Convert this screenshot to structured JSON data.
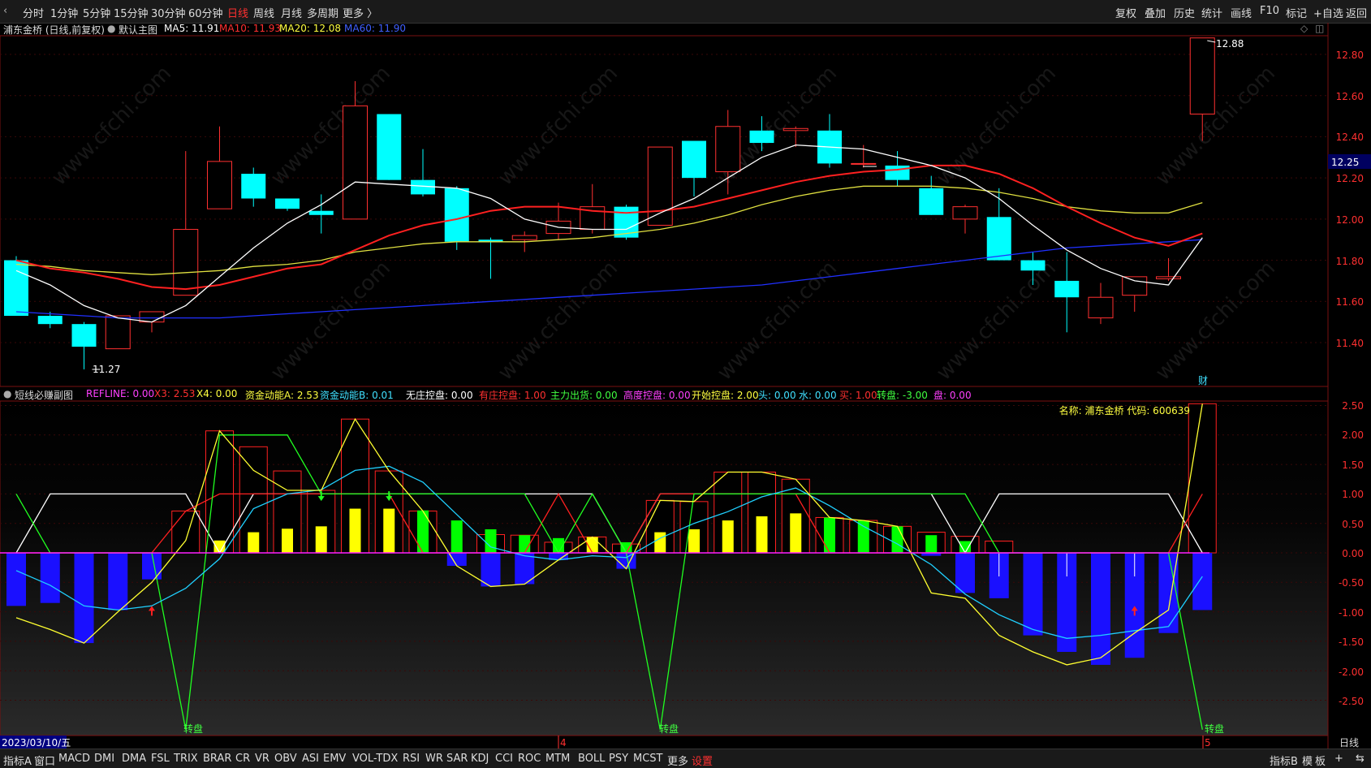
{
  "top_toolbar": {
    "periods": [
      "分时",
      "1分钟",
      "5分钟",
      "15分钟",
      "30分钟",
      "60分钟",
      "日线",
      "周线",
      "月线",
      "多周期",
      "更多 〉"
    ],
    "active": "日线",
    "right_buttons": [
      "复权",
      "叠加",
      "历史",
      "统计",
      "画线",
      "F10",
      "标记",
      "+自选",
      "返回"
    ]
  },
  "main_chart": {
    "title": "浦东金桥 (日线,前复权)",
    "indicator_name": "默认主图",
    "ma5": "MA5: 11.91",
    "ma10": "MA10: 11.93",
    "ma20": "MA20: 12.08",
    "ma60": "MA60: 11.90",
    "y_ticks": [
      "12.80",
      "12.60",
      "12.40",
      "12.20",
      "12.00",
      "11.80",
      "11.60",
      "11.40"
    ],
    "current_price": "12.25",
    "high_label": "12.88",
    "low_label": "11.27",
    "cai_label": "财"
  },
  "sub_chart": {
    "title": "短线必赚副图",
    "refline": "REFLINE: 0.00",
    "x3": "X3: 2.53",
    "x4": "X4: 0.00",
    "zjA": "资金动能A: 2.53",
    "zjB": "资金动能B: 0.01",
    "wzkp": "无庄控盘: 0.00",
    "yzkp": "有庄控盘: 1.00",
    "zlch": "主力出货: 0.00",
    "gdkp": "高度控盘: 0.00",
    "kskp": "开始控盘: 2.00",
    "tou": "头: 0.00",
    "shui": "水: 0.00",
    "mai": "买: 1.00",
    "zhuanpan": "转盘: -3.00",
    "pan": "盘: 0.00",
    "name_code": "名称: 浦东金桥 代码: 600639",
    "y_ticks": [
      "2.50",
      "2.00",
      "1.50",
      "1.00",
      "0.50",
      "0.00",
      "-0.50",
      "-1.00",
      "-1.50",
      "-2.00",
      "-2.50"
    ],
    "zp_labels": [
      "转盘",
      "转盘",
      "转盘"
    ]
  },
  "x_axis": {
    "date": "2023/03/10/五",
    "m4": "4",
    "m5": "5",
    "period": "日线"
  },
  "bottom_tabs": [
    "指标A",
    "窗口",
    "MACD",
    "DMI",
    "DMA",
    "FSL",
    "TRIX",
    "BRAR",
    "CR",
    "VR",
    "OBV",
    "ASI",
    "EMV",
    "VOL-TDX",
    "RSI",
    "WR",
    "SAR",
    "KDJ",
    "CCI",
    "ROC",
    "MTM",
    "BOLL",
    "PSY",
    "MCST",
    "更多",
    "设置"
  ],
  "bottom_right": [
    "指标B",
    "模",
    "板",
    "+",
    "⇆"
  ],
  "watermark": "www.cfchi.com",
  "chart_data": {
    "type": "candlestick",
    "candles": [
      {
        "o": 11.8,
        "h": 11.82,
        "l": 11.53,
        "c": 11.53
      },
      {
        "o": 11.53,
        "h": 11.55,
        "l": 11.47,
        "c": 11.49
      },
      {
        "o": 11.49,
        "h": 11.5,
        "l": 11.27,
        "c": 11.38
      },
      {
        "o": 11.37,
        "h": 11.53,
        "l": 11.37,
        "c": 11.53
      },
      {
        "o": 11.5,
        "h": 11.53,
        "l": 11.45,
        "c": 11.55
      },
      {
        "o": 11.63,
        "h": 12.33,
        "l": 11.63,
        "c": 11.95
      },
      {
        "o": 12.05,
        "h": 12.45,
        "l": 12.05,
        "c": 12.28
      },
      {
        "o": 12.22,
        "h": 12.25,
        "l": 12.06,
        "c": 12.1
      },
      {
        "o": 12.1,
        "h": 12.1,
        "l": 12.04,
        "c": 12.05
      },
      {
        "o": 12.04,
        "h": 12.12,
        "l": 11.93,
        "c": 12.02
      },
      {
        "o": 12.0,
        "h": 12.67,
        "l": 12.0,
        "c": 12.55
      },
      {
        "o": 12.51,
        "h": 12.51,
        "l": 12.19,
        "c": 12.19
      },
      {
        "o": 12.19,
        "h": 12.34,
        "l": 12.11,
        "c": 12.12
      },
      {
        "o": 12.15,
        "h": 12.16,
        "l": 11.85,
        "c": 11.89
      },
      {
        "o": 11.9,
        "h": 11.91,
        "l": 11.71,
        "c": 11.89
      },
      {
        "o": 11.9,
        "h": 11.94,
        "l": 11.84,
        "c": 11.92
      },
      {
        "o": 11.93,
        "h": 12.08,
        "l": 11.9,
        "c": 11.99
      },
      {
        "o": 11.95,
        "h": 12.17,
        "l": 11.93,
        "c": 12.06
      },
      {
        "o": 12.06,
        "h": 12.07,
        "l": 11.9,
        "c": 11.91
      },
      {
        "o": 11.97,
        "h": 12.35,
        "l": 11.97,
        "c": 12.35
      },
      {
        "o": 12.38,
        "h": 12.38,
        "l": 12.11,
        "c": 12.2
      },
      {
        "o": 12.23,
        "h": 12.53,
        "l": 12.12,
        "c": 12.45
      },
      {
        "o": 12.43,
        "h": 12.5,
        "l": 12.33,
        "c": 12.37
      },
      {
        "o": 12.43,
        "h": 12.45,
        "l": 12.35,
        "c": 12.44
      },
      {
        "o": 12.43,
        "h": 12.51,
        "l": 12.25,
        "c": 12.27
      },
      {
        "o": 12.27,
        "h": 12.36,
        "l": 12.25,
        "c": 12.27
      },
      {
        "o": 12.26,
        "h": 12.33,
        "l": 12.16,
        "c": 12.19
      },
      {
        "o": 12.15,
        "h": 12.21,
        "l": 12.02,
        "c": 12.02
      },
      {
        "o": 12.0,
        "h": 12.07,
        "l": 11.93,
        "c": 12.06
      },
      {
        "o": 12.01,
        "h": 12.15,
        "l": 11.8,
        "c": 11.8
      },
      {
        "o": 11.8,
        "h": 11.84,
        "l": 11.68,
        "c": 11.75
      },
      {
        "o": 11.7,
        "h": 11.84,
        "l": 11.45,
        "c": 11.62
      },
      {
        "o": 11.52,
        "h": 11.69,
        "l": 11.49,
        "c": 11.62
      },
      {
        "o": 11.63,
        "h": 11.71,
        "l": 11.55,
        "c": 11.72
      },
      {
        "o": 11.71,
        "h": 11.81,
        "l": 11.7,
        "c": 11.72
      },
      {
        "o": 12.51,
        "h": 12.88,
        "l": 12.38,
        "c": 12.88
      }
    ],
    "ma5": [
      11.75,
      11.68,
      11.58,
      11.52,
      11.5,
      11.58,
      11.72,
      11.86,
      11.98,
      12.07,
      12.18,
      12.17,
      12.16,
      12.15,
      12.1,
      12.0,
      11.96,
      11.95,
      11.95,
      12.03,
      12.1,
      12.2,
      12.3,
      12.36,
      12.35,
      12.34,
      12.3,
      12.26,
      12.2,
      12.1,
      11.97,
      11.85,
      11.76,
      11.7,
      11.68,
      11.91
    ],
    "ma10": [
      11.8,
      11.76,
      11.74,
      11.71,
      11.67,
      11.66,
      11.68,
      11.72,
      11.76,
      11.78,
      11.85,
      11.92,
      11.97,
      12.0,
      12.04,
      12.06,
      12.06,
      12.04,
      12.03,
      12.04,
      12.06,
      12.1,
      12.14,
      12.18,
      12.21,
      12.23,
      12.24,
      12.26,
      12.26,
      12.22,
      12.15,
      12.06,
      11.98,
      11.91,
      11.87,
      11.93
    ],
    "ma20": [
      11.78,
      11.77,
      11.75,
      11.74,
      11.73,
      11.74,
      11.75,
      11.77,
      11.78,
      11.8,
      11.84,
      11.86,
      11.88,
      11.89,
      11.89,
      11.89,
      11.9,
      11.91,
      11.93,
      11.95,
      11.98,
      12.02,
      12.07,
      12.11,
      12.14,
      12.16,
      12.16,
      12.16,
      12.15,
      12.13,
      12.1,
      12.06,
      12.04,
      12.03,
      12.03,
      12.08
    ],
    "ma60": [
      11.55,
      11.54,
      11.53,
      11.52,
      11.52,
      11.52,
      11.52,
      11.53,
      11.54,
      11.55,
      11.56,
      11.57,
      11.58,
      11.59,
      11.6,
      11.61,
      11.62,
      11.63,
      11.64,
      11.65,
      11.66,
      11.67,
      11.68,
      11.7,
      11.72,
      11.74,
      11.76,
      11.78,
      11.8,
      11.82,
      11.84,
      11.86,
      11.87,
      11.88,
      11.89,
      11.9
    ],
    "osc_bar": [
      -0.9,
      -0.85,
      -1.53,
      -0.97,
      -0.45,
      0.0,
      0.0,
      0.0,
      0.0,
      0.0,
      0.0,
      0.0,
      0.0,
      -0.22,
      -0.57,
      -0.53,
      -0.12,
      0.0,
      -0.27,
      0.0,
      0.0,
      0.0,
      0.0,
      0.0,
      0.0,
      0.0,
      0.0,
      -0.05,
      -0.68,
      -0.77,
      -1.4,
      -1.68,
      -1.9,
      -1.78,
      -1.36,
      -0.97
    ],
    "osc_positive": [
      0.0,
      0.0,
      0.0,
      0.0,
      0.0,
      0.71,
      2.07,
      1.8,
      1.39,
      1.06,
      2.27,
      1.39,
      0.71,
      0.0,
      0.31,
      0.3,
      0.18,
      0.27,
      0.15,
      0.89,
      0.87,
      1.37,
      1.37,
      1.25,
      0.6,
      0.55,
      0.45,
      0.35,
      0.28,
      0.2,
      0.0,
      0.0,
      0.0,
      0.0,
      0.0,
      2.53
    ],
    "yellow_bar": [
      0,
      0,
      0,
      0,
      0,
      0,
      0.21,
      0.35,
      0.41,
      0.45,
      0.75,
      0.75,
      0,
      0,
      0,
      0,
      0,
      0.27,
      0,
      0.35,
      0.4,
      0.55,
      0.62,
      0.67,
      0,
      0,
      0,
      0,
      0,
      0,
      0,
      0,
      0,
      0,
      0,
      0
    ],
    "green_bar": [
      0,
      0,
      0,
      0,
      0,
      0,
      0,
      0,
      0,
      0,
      0,
      0,
      0.72,
      0.55,
      0.4,
      0.3,
      0.25,
      0,
      0.18,
      0,
      0,
      0,
      0,
      0,
      0.6,
      0.55,
      0.45,
      0.3,
      0.2,
      0,
      0,
      0,
      0,
      0,
      0,
      0
    ],
    "cyan_line": [
      -0.3,
      -0.55,
      -0.9,
      -0.97,
      -0.9,
      -0.6,
      -0.1,
      0.75,
      1.0,
      1.07,
      1.4,
      1.47,
      1.2,
      0.65,
      0.1,
      -0.05,
      -0.12,
      -0.05,
      -0.08,
      0.25,
      0.5,
      0.7,
      0.95,
      1.1,
      0.8,
      0.45,
      0.15,
      -0.2,
      -0.7,
      -1.05,
      -1.3,
      -1.45,
      -1.4,
      -1.32,
      -1.25,
      -0.4
    ],
    "white_line": [
      0.0,
      1.0,
      1.0,
      1.0,
      1.0,
      1.0,
      0.0,
      1.0,
      1.0,
      1.0,
      1.0,
      1.0,
      1.0,
      1.0,
      1.0,
      1.0,
      1.0,
      1.0,
      0.0,
      1.0,
      1.0,
      1.0,
      1.0,
      1.0,
      1.0,
      1.0,
      1.0,
      1.0,
      0.0,
      1.0,
      1.0,
      1.0,
      1.0,
      1.0,
      1.0,
      0.0
    ],
    "green_line": [
      1.0,
      0.0,
      0.0,
      0.0,
      0.0,
      -3.0,
      2.0,
      2.0,
      2.0,
      1.0,
      1.0,
      1.0,
      1.0,
      1.0,
      1.0,
      1.0,
      0.0,
      1.0,
      0.0,
      -3.0,
      1.0,
      1.0,
      1.0,
      1.0,
      1.0,
      1.0,
      1.0,
      1.0,
      1.0,
      0.0,
      0.0,
      0.0,
      0.0,
      0.0,
      0.0,
      -3.0
    ],
    "yellow_line": [
      -1.1,
      -1.3,
      -1.53,
      -1.0,
      -0.5,
      0.21,
      2.07,
      1.4,
      1.06,
      1.06,
      2.27,
      1.39,
      0.71,
      -0.22,
      -0.57,
      -0.53,
      -0.12,
      0.27,
      -0.27,
      0.89,
      0.87,
      1.37,
      1.37,
      1.25,
      0.6,
      0.55,
      0.45,
      -0.68,
      -0.77,
      -1.4,
      -1.68,
      -1.9,
      -1.78,
      -1.36,
      -0.97,
      2.53
    ],
    "red_line": [
      0,
      0,
      0,
      0,
      0,
      0.71,
      1.0,
      1.0,
      1.0,
      1.0,
      1.0,
      1.0,
      0.0,
      0.0,
      0.0,
      0.0,
      1.0,
      0.0,
      0.0,
      1.0,
      1.0,
      1.0,
      1.0,
      1.0,
      0.0,
      0.0,
      0.0,
      0.0,
      0.0,
      0.0,
      0.0,
      0.0,
      0.0,
      0.0,
      0.0,
      1.0
    ],
    "buy_arrows": [
      4,
      33
    ],
    "sell_arrows": [
      9,
      11
    ],
    "zp_index": [
      5,
      19,
      35
    ]
  }
}
